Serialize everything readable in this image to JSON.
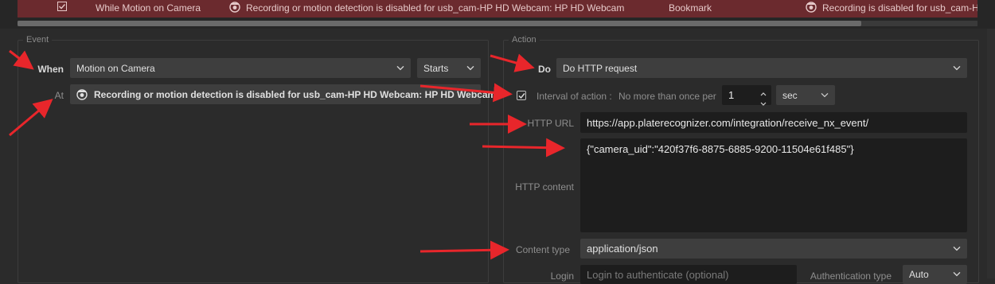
{
  "rule_row": {
    "condition": "While Motion on Camera",
    "source_text": "Recording or motion detection is disabled for usb_cam-HP HD Webcam: HP HD Webcam",
    "action": "Bookmark",
    "target_text": "Recording is disabled for usb_cam-HP HD Webcam"
  },
  "event": {
    "legend": "Event",
    "when_label": "When",
    "when_value": "Motion on Camera",
    "starts_value": "Starts",
    "at_label": "At",
    "at_value": "Recording or motion detection is disabled for usb_cam-HP HD Webcam: HP HD Webcam"
  },
  "action": {
    "legend": "Action",
    "do_label": "Do",
    "do_value": "Do HTTP request",
    "interval_label": "Interval of action :",
    "interval_text": "No more than once per",
    "interval_value": "1",
    "interval_unit": "sec",
    "url_label": "HTTP URL",
    "url_value": "https://app.platerecognizer.com/integration/receive_nx_event/",
    "content_label": "HTTP content",
    "content_value": "{\"camera_uid\":\"420f37f6-8875-6885-9200-11504e61f485\"}",
    "content_type_label": "Content type",
    "content_type_value": "application/json",
    "login_label": "Login",
    "login_placeholder": "Login to authenticate (optional)",
    "auth_label": "Authentication type",
    "auth_value": "Auto"
  },
  "colors": {
    "rule_row_bg": "#6b2a2e",
    "annotation_arrow": "#e8262b"
  },
  "icons": [
    "checkbox-checked-icon",
    "camera-icon",
    "chevron-down-icon",
    "spin-up-icon",
    "spin-down-icon",
    "annotation-arrow"
  ]
}
